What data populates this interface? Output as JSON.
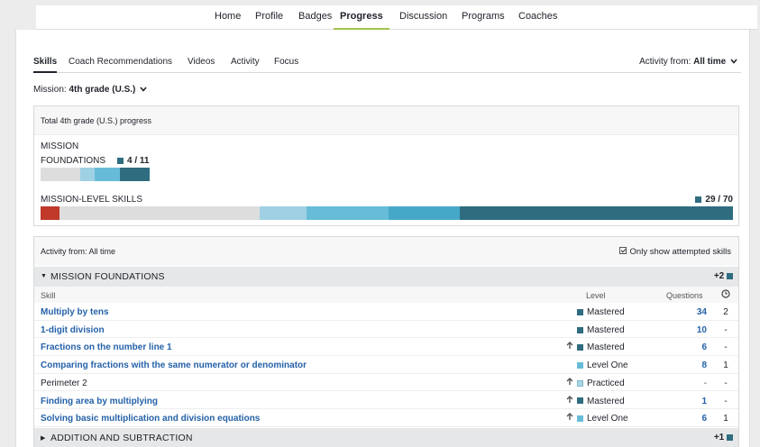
{
  "colors": {
    "mastered": "#2f6c80",
    "level_two": "#46a8c8",
    "level_one": "#66bcd8",
    "familiar": "#9fd0e4",
    "practiced": "#a9d7e8",
    "attempted": "#c0392b",
    "not_started": "#dddddd",
    "struggling": "#b83820"
  },
  "nav": {
    "items": [
      "Home",
      "Profile",
      "Badges",
      "Progress",
      "Discussion",
      "Programs",
      "Coaches"
    ],
    "active": "Progress"
  },
  "subtabs": {
    "items": [
      "Skills",
      "Coach Recommendations",
      "Videos",
      "Activity",
      "Focus"
    ],
    "activity_from_label": "Activity from:",
    "activity_from_value": "All time"
  },
  "mission": {
    "label": "Mission:",
    "value": "4th grade (U.S.)"
  },
  "progress": {
    "title": "Total 4th grade (U.S.) progress",
    "foundations_label_1": "MISSION",
    "foundations_label_2": "FOUNDATIONS",
    "foundations_count": "4 / 11",
    "foundations_bar": [
      {
        "status": "not_started",
        "fraction": 0.364
      },
      {
        "status": "familiar",
        "fraction": 0.136
      },
      {
        "status": "level_one",
        "fraction": 0.227
      },
      {
        "status": "mastered",
        "fraction": 0.273
      }
    ],
    "skills_label": "MISSION-LEVEL SKILLS",
    "skills_count": "29 / 70",
    "skills_bar": [
      {
        "status": "attempted",
        "fraction": 0.027
      },
      {
        "status": "not_started",
        "fraction": 0.29
      },
      {
        "status": "familiar",
        "fraction": 0.067
      },
      {
        "status": "level_one",
        "fraction": 0.118
      },
      {
        "status": "level_two",
        "fraction": 0.104
      },
      {
        "status": "mastered",
        "fraction": 0.394
      }
    ]
  },
  "activity": {
    "title": "Activity from: All time",
    "only_attempted": "Only show attempted skills",
    "sections": [
      {
        "title": "MISSION FOUNDATIONS",
        "plus": "+2",
        "expanded": true
      },
      {
        "title": "ADDITION AND SUBTRACTION",
        "plus": "+1",
        "expanded": false
      }
    ],
    "columns": {
      "skill": "Skill",
      "level": "Level",
      "questions": "Questions",
      "time_icon": "clock-icon"
    },
    "rows": [
      {
        "name": "Multiply by tens",
        "link": true,
        "up": false,
        "level": "Mastered",
        "status": "mastered",
        "questions": "34",
        "time": "2"
      },
      {
        "name": "1-digit division",
        "link": true,
        "up": false,
        "level": "Mastered",
        "status": "mastered",
        "questions": "10",
        "time": "-"
      },
      {
        "name": "Fractions on the number line 1",
        "link": true,
        "up": true,
        "level": "Mastered",
        "status": "mastered",
        "questions": "6",
        "time": "-"
      },
      {
        "name": "Comparing fractions with the same numerator or denominator",
        "link": true,
        "up": false,
        "level": "Level One",
        "status": "level_one",
        "questions": "8",
        "time": "1"
      },
      {
        "name": "Perimeter 2",
        "link": false,
        "up": true,
        "level": "Practiced",
        "status": "practiced",
        "questions": "-",
        "time": "-"
      },
      {
        "name": "Finding area by multiplying",
        "link": true,
        "up": true,
        "level": "Mastered",
        "status": "mastered",
        "questions": "1",
        "time": "-"
      },
      {
        "name": "Solving basic multiplication and division equations",
        "link": true,
        "up": true,
        "level": "Level One",
        "status": "level_one",
        "questions": "6",
        "time": "1"
      }
    ]
  }
}
